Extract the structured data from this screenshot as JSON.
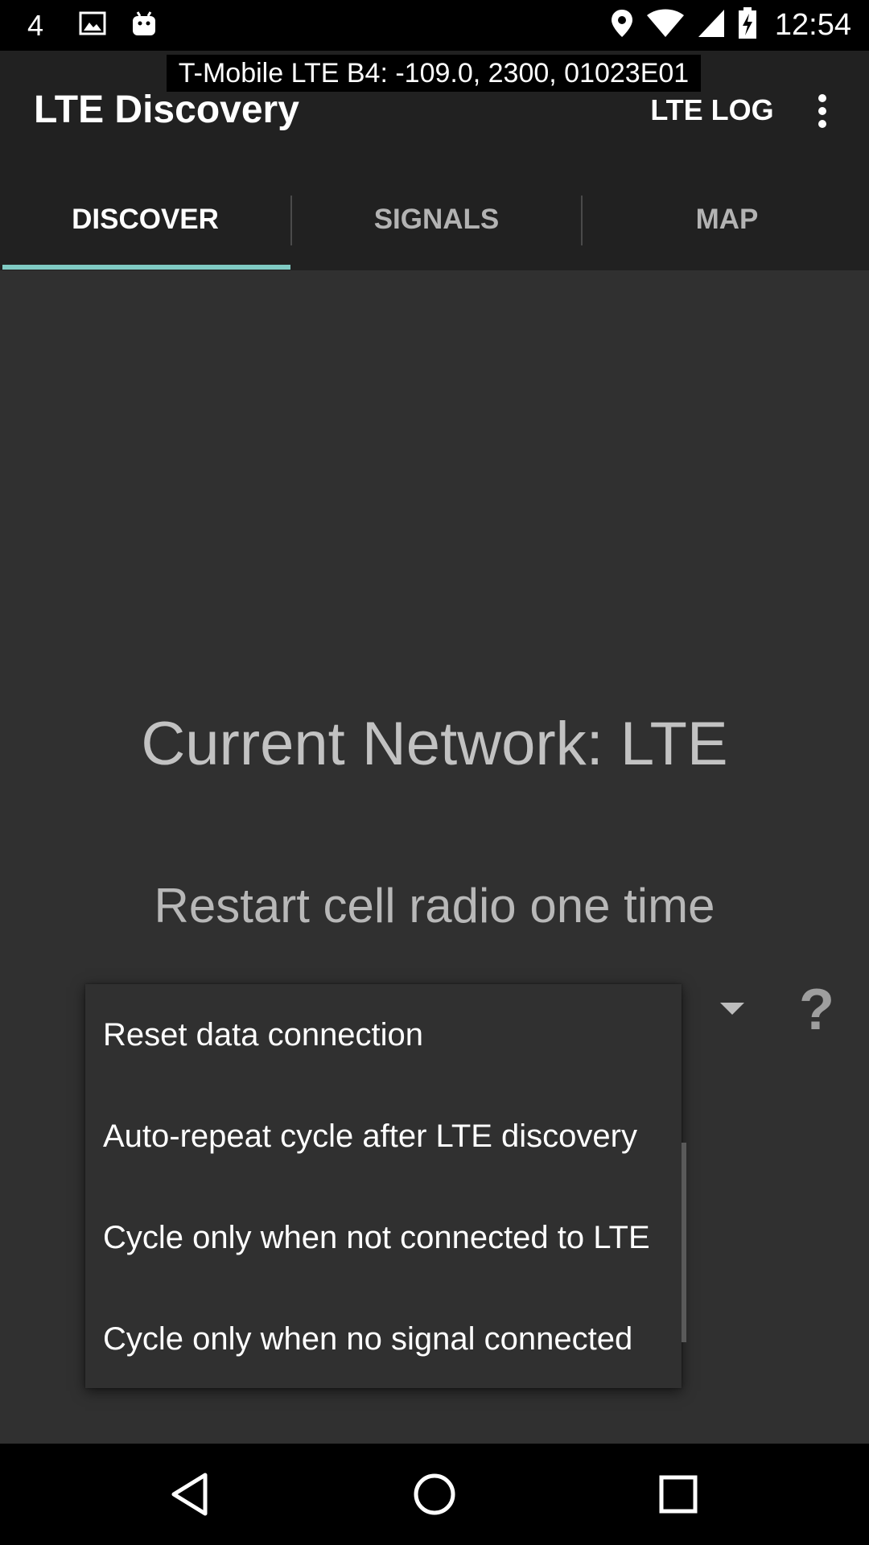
{
  "status_bar": {
    "notification_count": "4",
    "time": "12:54",
    "left_icons": [
      "image-icon",
      "android-icon"
    ],
    "right_icons": [
      "location-pin-icon",
      "wifi-icon",
      "cell-signal-icon",
      "battery-charging-icon"
    ]
  },
  "signal_overlay": "T-Mobile LTE B4: -109.0, 2300, 01023E01",
  "toolbar": {
    "title": "LTE Discovery",
    "lte_log_label": "LTE LOG",
    "overflow_icon": "more-vert-icon"
  },
  "tabs": [
    {
      "label": "DISCOVER",
      "active": true
    },
    {
      "label": "SIGNALS",
      "active": false
    },
    {
      "label": "MAP",
      "active": false
    }
  ],
  "main": {
    "current_network": "Current Network: LTE",
    "restart_text": "Restart cell radio one time",
    "help_label": "?"
  },
  "dropdown": {
    "items": [
      "Reset data connection",
      "Auto-repeat cycle after LTE discovery",
      "Cycle only when not connected to LTE",
      "Cycle only when no signal connected"
    ]
  },
  "nav_bar": {
    "icons": [
      "back-icon",
      "home-icon",
      "recents-icon"
    ]
  },
  "colors": {
    "accent": "#80cbc4",
    "appbar": "#212121",
    "background": "#303030"
  }
}
